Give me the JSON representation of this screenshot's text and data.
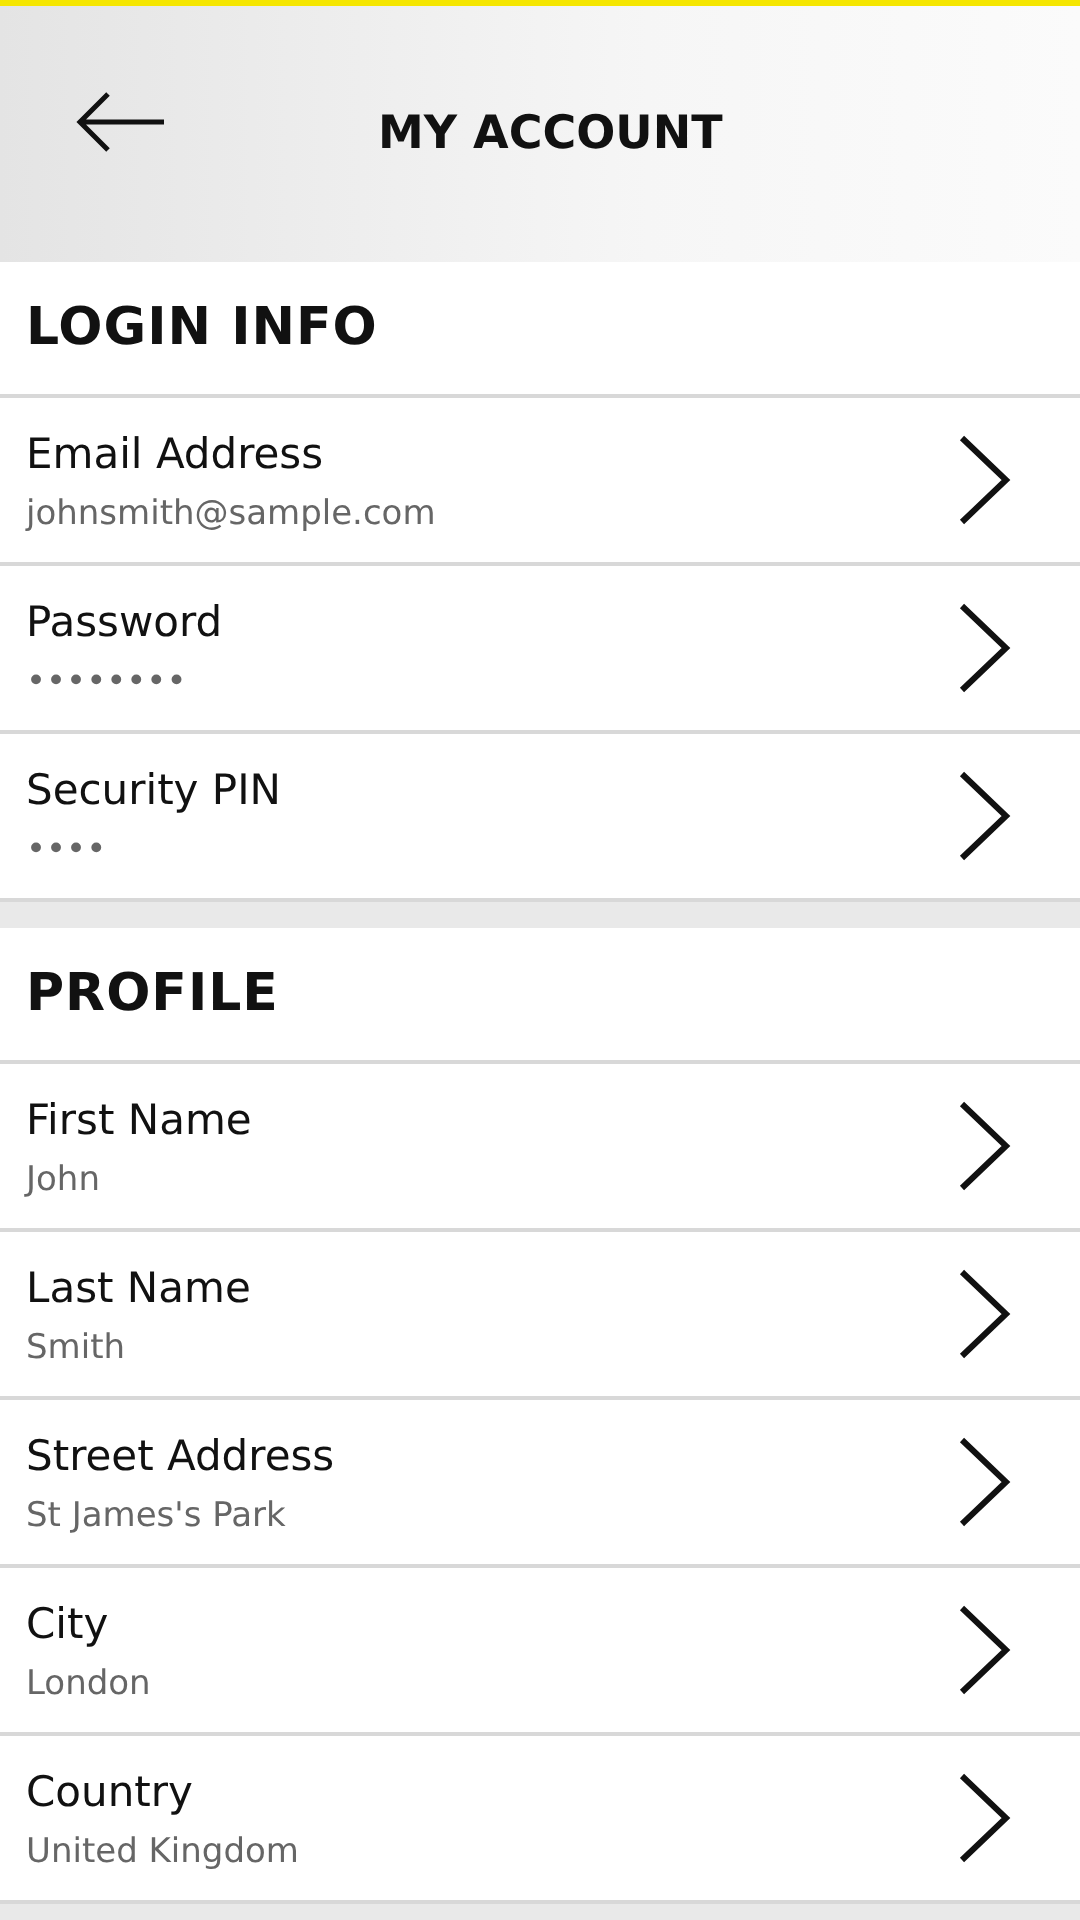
{
  "header": {
    "title": "MY ACCOUNT"
  },
  "sections": [
    {
      "title": "LOGIN INFO",
      "rows": [
        {
          "label": "Email Address",
          "value": "johnsmith@sample.com"
        },
        {
          "label": "Password",
          "value": "••••••••"
        },
        {
          "label": "Security PIN",
          "value": "••••"
        }
      ]
    },
    {
      "title": "PROFILE",
      "rows": [
        {
          "label": "First Name",
          "value": "John"
        },
        {
          "label": "Last Name",
          "value": "Smith"
        },
        {
          "label": "Street Address",
          "value": "St James's Park"
        },
        {
          "label": "City",
          "value": "London"
        },
        {
          "label": "Country",
          "value": "United Kingdom"
        }
      ]
    }
  ]
}
